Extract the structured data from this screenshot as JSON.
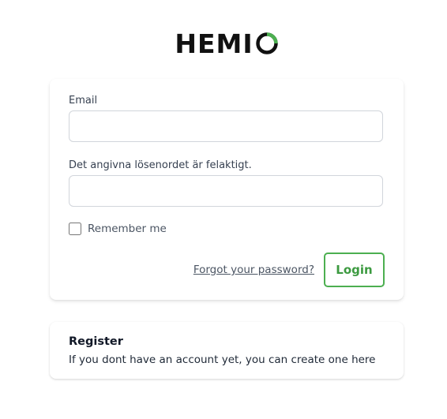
{
  "brand": {
    "name": "HEMI",
    "logo_icon": "ring-o-icon",
    "accent_color": "#4caf50"
  },
  "login_form": {
    "email_label": "Email",
    "email_value": "",
    "password_label": "Det angivna lösenordet är felaktigt.",
    "password_value": "",
    "remember_label": "Remember me",
    "remember_checked": false,
    "forgot_link": "Forgot your password?",
    "login_button": "Login"
  },
  "register": {
    "title": "Register",
    "text": "If you dont have an account yet, you can create one here"
  }
}
